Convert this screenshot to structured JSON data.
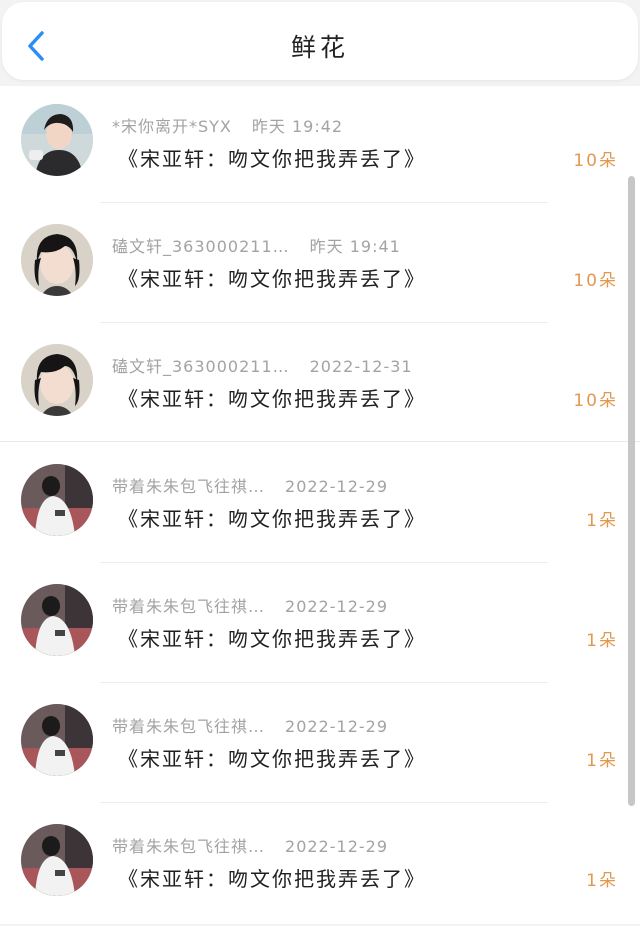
{
  "header": {
    "title": "鲜花"
  },
  "colors": {
    "accent": "#2a8ef5",
    "count": "#e2984f",
    "meta": "#a3a3a3"
  },
  "rows": [
    {
      "user": "*宋你离开*SYX",
      "time": "昨天 19:42",
      "message": "《宋亚轩：吻文你把我弄丢了》",
      "count": "10朵"
    },
    {
      "user": "磕文轩_363000211…",
      "time": "昨天 19:41",
      "message": "《宋亚轩：吻文你把我弄丢了》",
      "count": "10朵"
    },
    {
      "user": "磕文轩_363000211…",
      "time": "2022-12-31",
      "message": "《宋亚轩：吻文你把我弄丢了》",
      "count": "10朵"
    },
    {
      "user": "带着朱朱包飞往祺…",
      "time": "2022-12-29",
      "message": "《宋亚轩：吻文你把我弄丢了》",
      "count": "1朵"
    },
    {
      "user": "带着朱朱包飞往祺…",
      "time": "2022-12-29",
      "message": "《宋亚轩：吻文你把我弄丢了》",
      "count": "1朵"
    },
    {
      "user": "带着朱朱包飞往祺…",
      "time": "2022-12-29",
      "message": "《宋亚轩：吻文你把我弄丢了》",
      "count": "1朵"
    },
    {
      "user": "带着朱朱包飞往祺…",
      "time": "2022-12-29",
      "message": "《宋亚轩：吻文你把我弄丢了》",
      "count": "1朵"
    }
  ]
}
